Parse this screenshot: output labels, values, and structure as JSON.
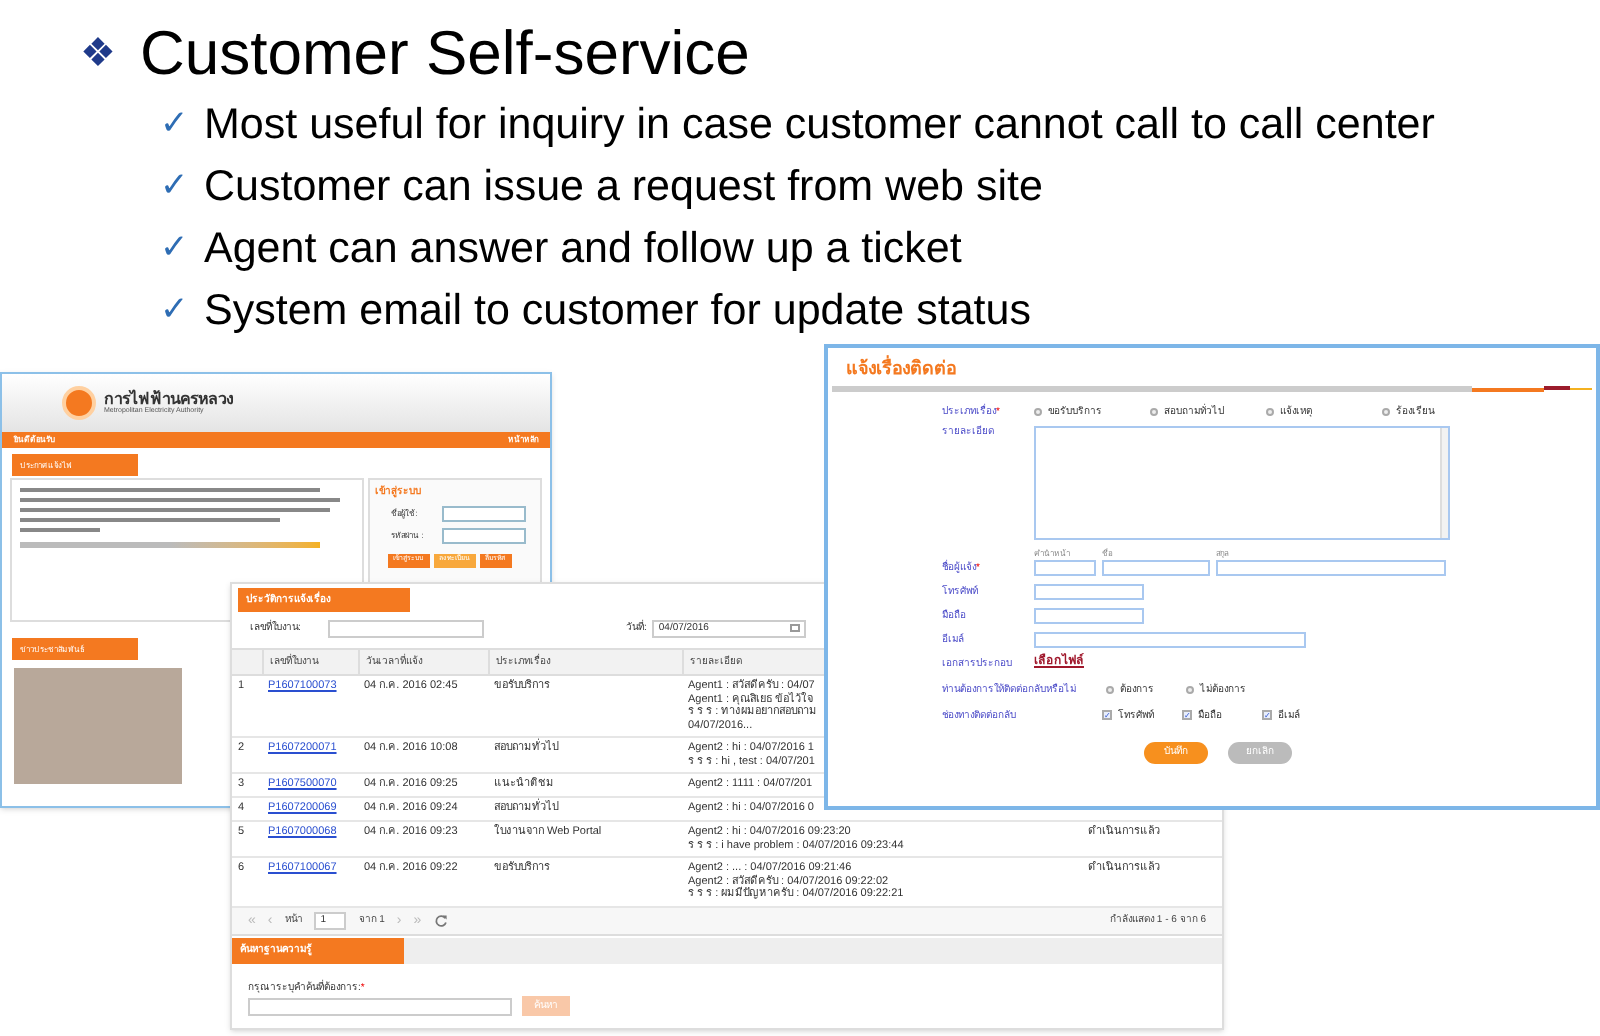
{
  "slide": {
    "bullet_icon": "❖",
    "title": "Customer Self-service",
    "points": [
      {
        "icon": "✓",
        "text": "Most useful for inquiry in case customer cannot call to call center"
      },
      {
        "icon": "✓",
        "text": "Customer can issue a request from web site"
      },
      {
        "icon": "✓",
        "text": "Agent can answer and follow up a ticket"
      },
      {
        "icon": "✓",
        "text": "System email to customer for update status"
      }
    ]
  },
  "portal": {
    "logo_title": "การไฟฟ้านครหลวง",
    "logo_subtitle": "Metropolitan Electricity Authority",
    "nav_left": "ยินดีต้อนรับ",
    "nav_right": "หน้าหลัก",
    "announce_tab": "ประกาศแจ้งไฟ",
    "login": {
      "title": "เข้าสู่ระบบ",
      "fields": [
        {
          "label": "ชื่อผู้ใช้:"
        },
        {
          "label": "รหัสผ่าน :"
        }
      ],
      "buttons": [
        "เข้าสู่ระบบ",
        "ลงทะเบียน",
        "ลืมรหัส"
      ]
    },
    "news_tab": "ข่าวประชาสัมพันธ์"
  },
  "history": {
    "title": "ประวัติการแจ้งเรื่อง",
    "filter_label": "เลขที่ใบงาน:",
    "date_label": "วันที่:",
    "date_value": "04/07/2016",
    "columns": [
      "เลขที่ใบงาน",
      "วันเวลาที่แจ้ง",
      "ประเภทเรื่อง",
      "รายละเอียด"
    ],
    "rows": [
      {
        "no": "1",
        "ticket": "P1607100073",
        "time": "04 ก.ค. 2016 02:45",
        "type": "ขอรับบริการ",
        "details": [
          "Agent1 : สวัสดีครับ : 04/07",
          "Agent1 : คุณสิเยธ ข้อไว้ใจ",
          "ร ร ร : ทางผมอยากสอบถาม",
          "04/07/2016..."
        ]
      },
      {
        "no": "2",
        "ticket": "P1607200071",
        "time": "04 ก.ค. 2016 10:08",
        "type": "สอบถามทั่วไป",
        "details": [
          "Agent2 : hi : 04/07/2016 1",
          "ร ร ร : hi , test : 04/07/201"
        ]
      },
      {
        "no": "3",
        "ticket": "P1607500070",
        "time": "04 ก.ค. 2016 09:25",
        "type": "แนะนำติชม",
        "details": [
          "Agent2 : 1111 : 04/07/201"
        ]
      },
      {
        "no": "4",
        "ticket": "P1607200069",
        "time": "04 ก.ค. 2016 09:24",
        "type": "สอบถามทั่วไป",
        "details": [
          "Agent2 : hi : 04/07/2016 0"
        ]
      },
      {
        "no": "5",
        "ticket": "P1607000068",
        "time": "04 ก.ค. 2016 09:23",
        "type": "ใบงานจาก Web Portal",
        "details": [
          "Agent2 : hi : 04/07/2016 09:23:20",
          "ร ร ร : i have problem : 04/07/2016 09:23:44"
        ],
        "status": "ดำเนินการแล้ว"
      },
      {
        "no": "6",
        "ticket": "P1607100067",
        "time": "04 ก.ค. 2016 09:22",
        "type": "ขอรับบริการ",
        "details": [
          "Agent2 : ... : 04/07/2016 09:21:46",
          "Agent2 : สวัสดีครับ : 04/07/2016 09:22:02",
          "ร ร ร : ผมมีปัญหาครับ : 04/07/2016 09:22:21"
        ],
        "status": "ดำเนินการแล้ว"
      }
    ],
    "pager": {
      "first": "«",
      "prev": "‹",
      "page_label": "หน้า",
      "page": "1",
      "of": "จาก 1",
      "next": "›",
      "last": "»",
      "summary": "กำลังแสดง 1 - 6 จาก 6"
    },
    "kb": {
      "title": "ค้นหาฐานความรู้",
      "label": "กรุณาระบุคำค้นที่ต้องการ:",
      "required": "*",
      "button": "ค้นหา"
    }
  },
  "form": {
    "title": "แจ้งเรื่องติดต่อ",
    "type_label": "ประเภทเรื่อง",
    "required": "*",
    "types": [
      {
        "label": "ขอรับบริการ",
        "selected": false
      },
      {
        "label": "สอบถามทั่วไป",
        "selected": false
      },
      {
        "label": "แจ้งเหตุ",
        "selected": false
      },
      {
        "label": "ร้องเรียน",
        "selected": false
      }
    ],
    "details_label": "รายละเอียด",
    "name_sublabels": [
      "คำนำหน้า",
      "ชื่อ",
      "สกุล"
    ],
    "name_label": "ชื่อผู้แจ้ง",
    "phone_label": "โทรศัพท์",
    "mobile_label": "มือถือ",
    "email_label": "อีเมล์",
    "attach_label": "เอกสารประกอบ",
    "attach_link": "เลือกไฟล์",
    "callback_label": "ท่านต้องการให้ติดต่อกลับหรือไม่",
    "callback_options": [
      {
        "label": "ต้องการ",
        "selected": false
      },
      {
        "label": "ไม่ต้องการ",
        "selected": false
      }
    ],
    "channel_label": "ช่องทางติดต่อกลับ",
    "channels": [
      {
        "label": "โทรศัพท์",
        "checked": true
      },
      {
        "label": "มือถือ",
        "checked": true
      },
      {
        "label": "อีเมล์",
        "checked": true
      }
    ],
    "save": "บันทึก",
    "cancel": "ยกเลิก"
  }
}
